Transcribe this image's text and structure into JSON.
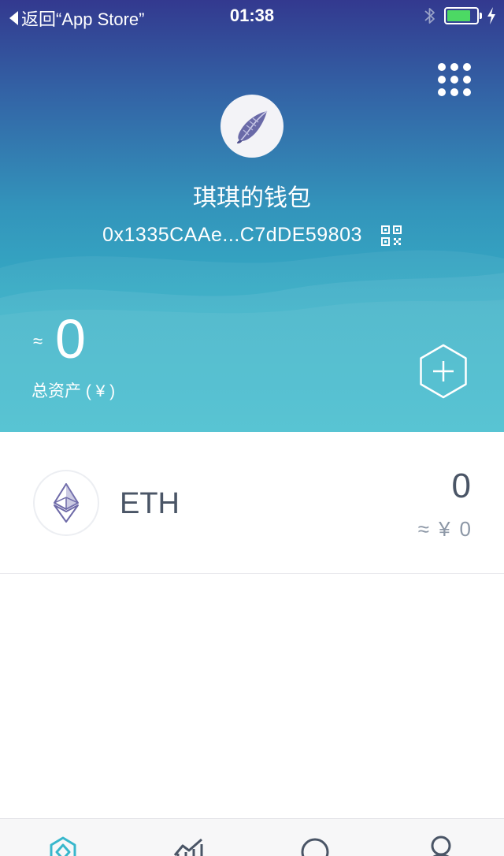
{
  "status_bar": {
    "back_label": "返回“App Store”",
    "time": "01:38",
    "icons": [
      "bluetooth-icon",
      "battery-icon",
      "charging-icon"
    ]
  },
  "header": {
    "wallet_name": "琪琪的钱包",
    "address": "0x1335CAAe...C7dDE59803",
    "total_approx": "≈",
    "total_value": "0",
    "total_label": "总资产 ( ¥ )",
    "icons": [
      "menu-grid-icon",
      "shell-avatar-icon",
      "qr-code-icon",
      "add-hexagon-icon"
    ]
  },
  "assets": [
    {
      "name": "ETH",
      "amount": "0",
      "fiat_approx": "≈",
      "fiat_currency": "¥",
      "fiat_value": "0",
      "icon": "ethereum-icon"
    }
  ],
  "tab_bar": {
    "tabs": [
      "wallet-tab-icon",
      "market-tab-icon",
      "discover-tab-icon",
      "profile-tab-icon"
    ]
  },
  "colors": {
    "gradient_top": "#33398f",
    "gradient_bottom": "#38b9cb",
    "active_tab": "#38b7cc",
    "text_dark": "#4a5566",
    "battery": "#4cd964"
  }
}
